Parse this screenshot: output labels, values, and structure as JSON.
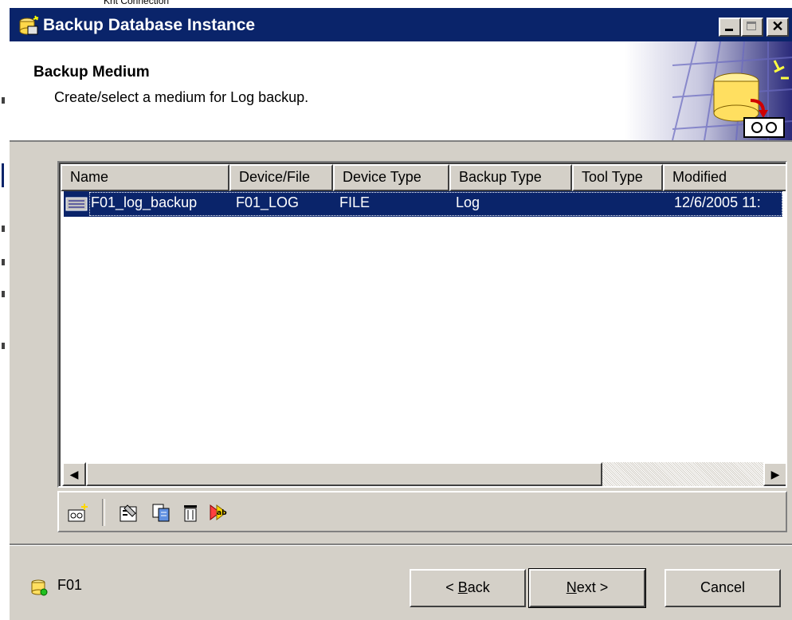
{
  "window": {
    "title": "Backup Database Instance",
    "controls": [
      "minimize",
      "maximize",
      "close"
    ]
  },
  "background": {
    "partial_text": "Krit Connection"
  },
  "header": {
    "title": "Backup Medium",
    "subtitle": "Create/select a medium for Log backup."
  },
  "list": {
    "columns": [
      "Name",
      "Device/File",
      "Device Type",
      "Backup Type",
      "Tool Type",
      "Modified"
    ],
    "rows": [
      {
        "name": "F01_log_backup",
        "device_file": "F01_LOG",
        "device_type": "FILE",
        "backup_type": "Log",
        "tool_type": "",
        "modified": "12/6/2005 11:"
      }
    ],
    "selected_row": 0
  },
  "toolbar": {
    "icons": [
      "new-medium-icon",
      "properties-icon",
      "copy-icon",
      "delete-icon",
      "rename-icon"
    ]
  },
  "footer": {
    "instance_label": "F01",
    "back_prefix": "< ",
    "back_key": "B",
    "back_rest": "ack",
    "next_key": "N",
    "next_rest": "ext >",
    "cancel_label": "Cancel"
  },
  "colors": {
    "title_bar": "#0a246a",
    "dialog_face": "#d4d0c8",
    "selection": "#0a246a"
  }
}
